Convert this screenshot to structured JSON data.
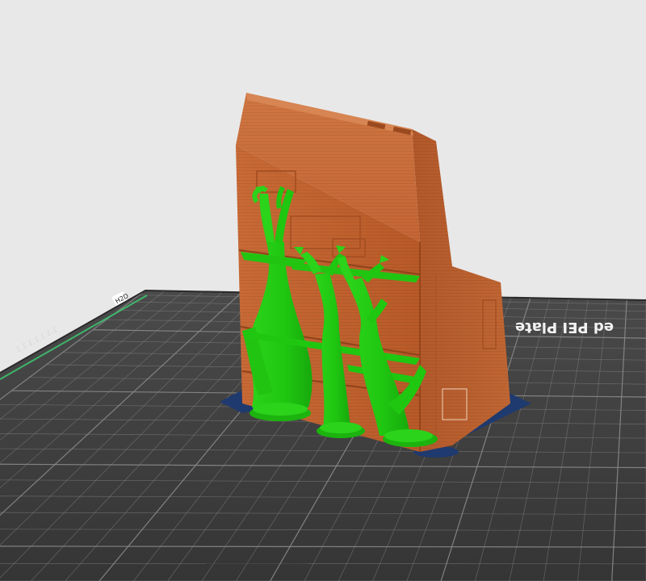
{
  "viewport": {
    "background_color": "#e8e8e8",
    "plate": {
      "label": "Textured PEI Plate",
      "visible_label": "ed PEI Plate",
      "left_marker_text": "H2D",
      "left_edge_text": "1.1.1.1.1.1.1",
      "bed_color": "#3f3f3f",
      "grid_color": "#8a8a8a"
    },
    "model": {
      "color": "#c0622f",
      "support_type": "tree",
      "support_color": "#22c912",
      "base_brim_color": "#1f3a6e"
    }
  }
}
